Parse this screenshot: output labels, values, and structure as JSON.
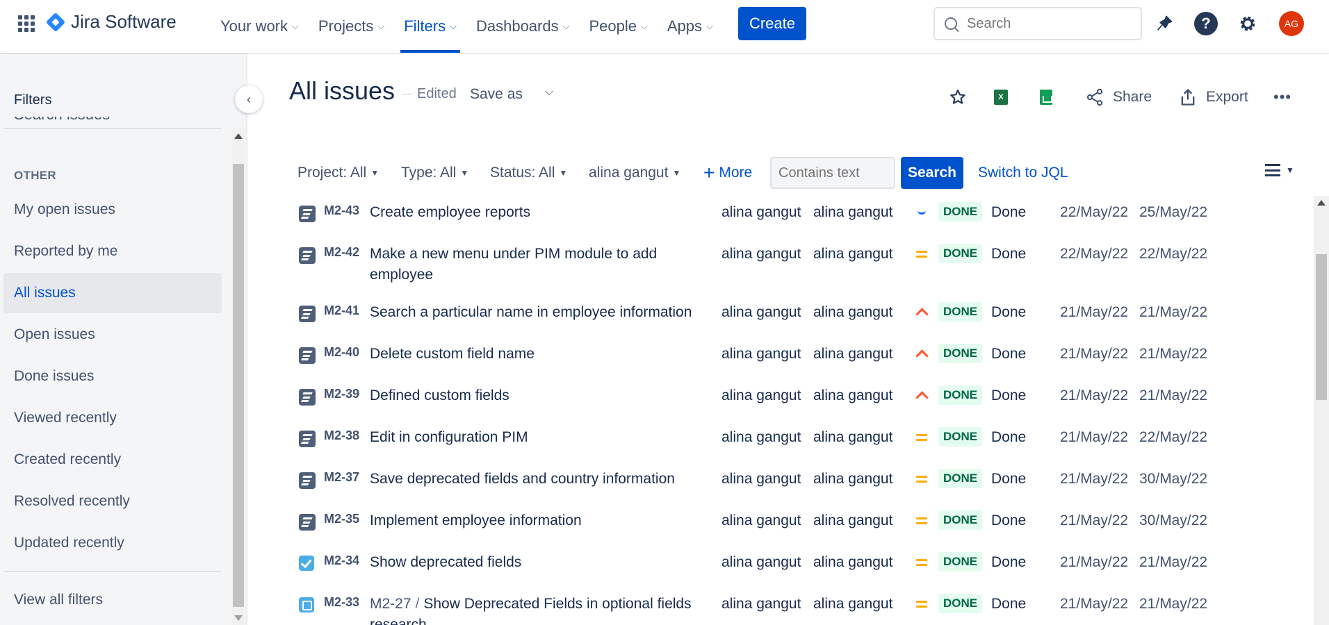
{
  "topnav": {
    "brand": "Jira Software",
    "items": [
      {
        "label": "Your work",
        "active": false
      },
      {
        "label": "Projects",
        "active": false
      },
      {
        "label": "Filters",
        "active": true
      },
      {
        "label": "Dashboards",
        "active": false
      },
      {
        "label": "People",
        "active": false
      },
      {
        "label": "Apps",
        "active": false
      }
    ],
    "create_label": "Create",
    "search_placeholder": "Search",
    "help_glyph": "?",
    "avatar_initials": "AG",
    "icons": [
      "app-switcher-icon",
      "notifications-icon",
      "help-icon",
      "settings-icon"
    ]
  },
  "sidebar": {
    "title": "Filters",
    "cut_item": "Search issues",
    "section_label": "OTHER",
    "items": [
      {
        "label": "My open issues",
        "selected": false
      },
      {
        "label": "Reported by me",
        "selected": false
      },
      {
        "label": "All issues",
        "selected": true
      },
      {
        "label": "Open issues",
        "selected": false
      },
      {
        "label": "Done issues",
        "selected": false
      },
      {
        "label": "Viewed recently",
        "selected": false
      },
      {
        "label": "Created recently",
        "selected": false
      },
      {
        "label": "Resolved recently",
        "selected": false
      },
      {
        "label": "Updated recently",
        "selected": false
      }
    ],
    "footer_link": "View all filters"
  },
  "header": {
    "title": "All issues",
    "edited": "Edited",
    "save_as": "Save as",
    "share": "Share",
    "export": "Export",
    "more_glyph": "•••"
  },
  "filters": {
    "project": "Project: All",
    "type": "Type: All",
    "status": "Status: All",
    "assignee": "alina gangut",
    "more": "More",
    "text_placeholder": "Contains text",
    "search_button": "Search",
    "switch_jql": "Switch to JQL"
  },
  "issues": [
    {
      "type": "epic",
      "key": "M2-43",
      "parent": "",
      "summary": "Create employee reports",
      "assignee": "alina gangut",
      "reporter": "alina gangut",
      "priority": "low",
      "status": "DONE",
      "resolution": "Done",
      "created": "22/May/22",
      "updated": "25/May/22"
    },
    {
      "type": "epic",
      "key": "M2-42",
      "parent": "",
      "summary": "Make a new menu under PIM module to add employee",
      "assignee": "alina gangut",
      "reporter": "alina gangut",
      "priority": "medium",
      "status": "DONE",
      "resolution": "Done",
      "created": "22/May/22",
      "updated": "22/May/22"
    },
    {
      "type": "epic",
      "key": "M2-41",
      "parent": "",
      "summary": "Search a particular name in employee information",
      "assignee": "alina gangut",
      "reporter": "alina gangut",
      "priority": "high",
      "status": "DONE",
      "resolution": "Done",
      "created": "21/May/22",
      "updated": "21/May/22"
    },
    {
      "type": "epic",
      "key": "M2-40",
      "parent": "",
      "summary": "Delete custom field name",
      "assignee": "alina gangut",
      "reporter": "alina gangut",
      "priority": "high",
      "status": "DONE",
      "resolution": "Done",
      "created": "21/May/22",
      "updated": "21/May/22"
    },
    {
      "type": "epic",
      "key": "M2-39",
      "parent": "",
      "summary": "Defined custom fields",
      "assignee": "alina gangut",
      "reporter": "alina gangut",
      "priority": "high",
      "status": "DONE",
      "resolution": "Done",
      "created": "21/May/22",
      "updated": "21/May/22"
    },
    {
      "type": "epic",
      "key": "M2-38",
      "parent": "",
      "summary": "Edit in configuration PIM",
      "assignee": "alina gangut",
      "reporter": "alina gangut",
      "priority": "medium",
      "status": "DONE",
      "resolution": "Done",
      "created": "21/May/22",
      "updated": "22/May/22"
    },
    {
      "type": "epic",
      "key": "M2-37",
      "parent": "",
      "summary": "Save deprecated fields and country information",
      "assignee": "alina gangut",
      "reporter": "alina gangut",
      "priority": "medium",
      "status": "DONE",
      "resolution": "Done",
      "created": "21/May/22",
      "updated": "30/May/22"
    },
    {
      "type": "epic",
      "key": "M2-35",
      "parent": "",
      "summary": "Implement employee information",
      "assignee": "alina gangut",
      "reporter": "alina gangut",
      "priority": "medium",
      "status": "DONE",
      "resolution": "Done",
      "created": "21/May/22",
      "updated": "30/May/22"
    },
    {
      "type": "task",
      "key": "M2-34",
      "parent": "",
      "summary": "Show deprecated fields",
      "assignee": "alina gangut",
      "reporter": "alina gangut",
      "priority": "medium",
      "status": "DONE",
      "resolution": "Done",
      "created": "21/May/22",
      "updated": "21/May/22"
    },
    {
      "type": "subtask",
      "key": "M2-33",
      "parent": "M2-27",
      "summary": "Show Deprecated Fields in optional fields research",
      "assignee": "alina gangut",
      "reporter": "alina gangut",
      "priority": "medium",
      "status": "DONE",
      "resolution": "Done",
      "created": "21/May/22",
      "updated": "21/May/22"
    }
  ],
  "colors": {
    "brand_blue": "#0052cc",
    "done_bg": "#e3fcef",
    "done_text": "#006644",
    "priority_high": "#ff5630",
    "priority_medium": "#ffab00",
    "priority_low": "#0065ff",
    "avatar": "#de350b"
  }
}
